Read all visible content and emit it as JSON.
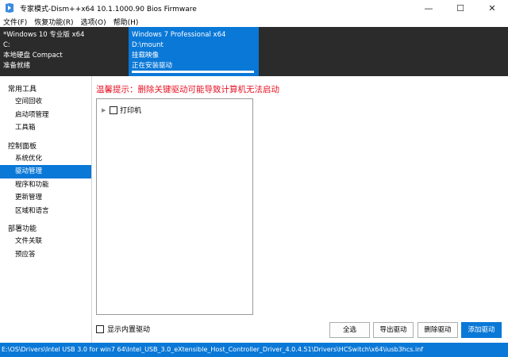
{
  "window": {
    "title": "专家模式-Dism++x64 10.1.1000.90 Bios Firmware",
    "controls": [
      "—",
      "☐",
      "✕"
    ]
  },
  "menu": {
    "items": [
      "文件(F)",
      "恢复功能(R)",
      "选项(O)",
      "帮助(H)"
    ]
  },
  "sessions": [
    {
      "os": "*Windows 10 专业版 x64",
      "path": "C:",
      "type": "本地硬盘 Compact",
      "status": "准备就绪"
    },
    {
      "os": "Windows 7 Professional x64",
      "path": "D:\\mount",
      "type": "挂载映像",
      "status": "正在安装驱动",
      "progress": 1.0
    }
  ],
  "sidebar": {
    "groups": [
      {
        "heading": "常用工具",
        "items": [
          "空间回收",
          "启动项管理",
          "工具箱"
        ]
      },
      {
        "heading": "控制面板",
        "items": [
          "系统优化",
          "驱动管理",
          "程序和功能",
          "更新管理",
          "区域和语言"
        ]
      },
      {
        "heading": "部署功能",
        "items": [
          "文件关联",
          "预应答"
        ]
      }
    ],
    "active_item": "驱动管理"
  },
  "main": {
    "warning": "温馨提示：删除关键驱动可能导致计算机无法启动",
    "tree": [
      {
        "label": "打印机",
        "checked": false,
        "expanded": false
      }
    ],
    "show_builtin_label": "显示内置驱动",
    "buttons": {
      "select_all": "全选",
      "export": "导出驱动",
      "delete": "删除驱动",
      "add": "添加驱动"
    }
  },
  "status_bar": "E:\\OS\\Drivers\\Intel USB 3.0 for win7 64\\Intel_USB_3.0_eXtensible_Host_Controller_Driver_4.0.4.51\\Drivers\\HCSwitch\\x64\\iusb3hcs.inf",
  "colors": {
    "accent": "#0a78d7",
    "session_bar": "#2b2b2b",
    "warning": "#e81123"
  }
}
